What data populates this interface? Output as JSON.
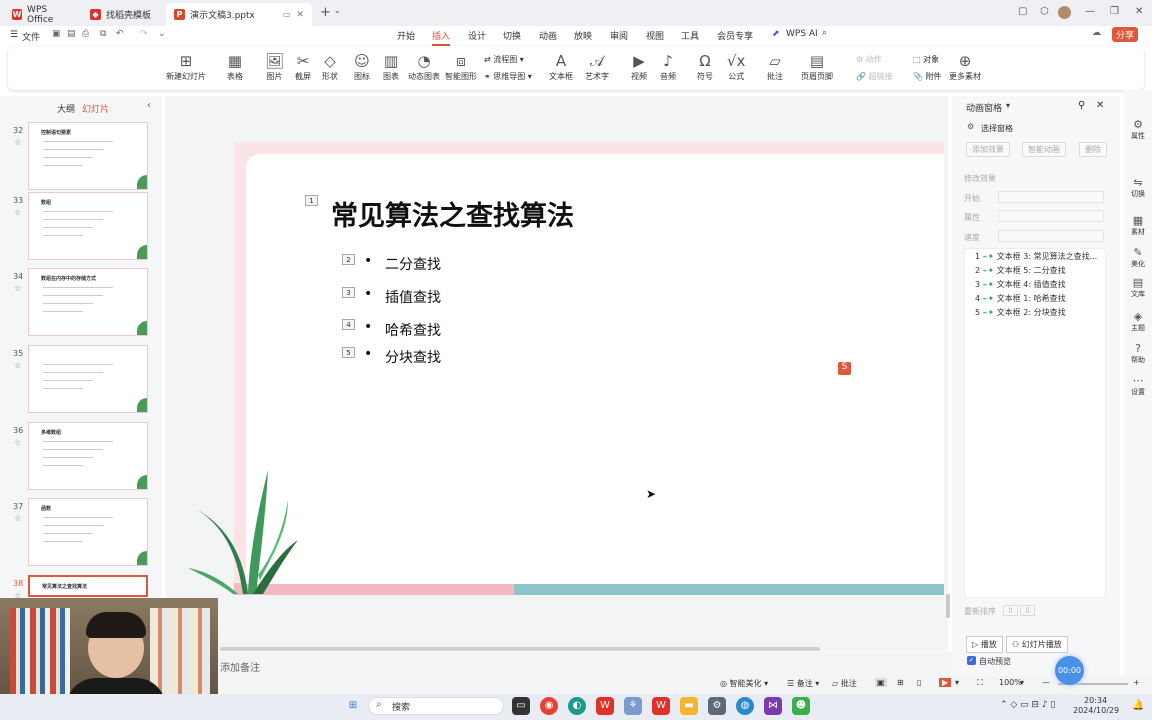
{
  "tabs": [
    {
      "label": "WPS Office",
      "icon": "wps-logo-icon",
      "color": "#e0312a"
    },
    {
      "label": "找稻壳模板",
      "icon": "daoke-icon",
      "color": "#e0312a"
    },
    {
      "label": "演示文稿3.pptx",
      "icon": "ppt-file-icon",
      "color": "#d9472b"
    }
  ],
  "menu": {
    "file": "文件",
    "items": [
      "开始",
      "插入",
      "设计",
      "切换",
      "动画",
      "放映",
      "审阅",
      "视图",
      "工具",
      "会员专享"
    ],
    "active": "插入",
    "wps_ai": "WPS AI",
    "share": "分享"
  },
  "ribbon": {
    "new_slide": "新建幻灯片",
    "table": "表格",
    "picture": "图片",
    "screenshot": "截屏",
    "shape": "形状",
    "icon": "图标",
    "chart": "图表",
    "dynamic_chart": "动态图表",
    "smart_graphic": "智能图形",
    "flowchart": "流程图",
    "mindmap": "思维导图",
    "textbox": "文本框",
    "wordart": "艺术字",
    "video": "视频",
    "audio": "音频",
    "symbol": "符号",
    "formula": "公式",
    "comment": "批注",
    "header_footer": "页眉页脚",
    "action": "动作",
    "hyperlink": "超链接",
    "object": "对象",
    "attachment": "附件",
    "more": "更多素材"
  },
  "left_panel": {
    "tab_outline": "大纲",
    "tab_slides": "幻灯片",
    "thumbnails": [
      {
        "num": "32",
        "title": "控制语句要素"
      },
      {
        "num": "33",
        "title": "数组"
      },
      {
        "num": "34",
        "title": "数组在内存中的存储方式"
      },
      {
        "num": "35",
        "title": ""
      },
      {
        "num": "36",
        "title": "多维数组"
      },
      {
        "num": "37",
        "title": "函数"
      },
      {
        "num": "38",
        "title": "常见算法之查找算法"
      }
    ]
  },
  "slide": {
    "title": "常见算法之查找算法",
    "title_num": "1",
    "bullets": [
      {
        "num": "2",
        "text": "二分查找"
      },
      {
        "num": "3",
        "text": "插值查找"
      },
      {
        "num": "4",
        "text": "哈希查找"
      },
      {
        "num": "5",
        "text": "分块查找"
      }
    ]
  },
  "notes_placeholder": "添加备注",
  "animation_pane": {
    "title": "动画窗格",
    "select_pane": "选择窗格",
    "add_effect": "添加效果",
    "smart_anim": "智能动画",
    "delete": "删除",
    "modify": "修改效果",
    "start": "开始",
    "property": "属性",
    "speed": "速度",
    "items": [
      {
        "num": "1",
        "text": "文本框 3: 常见算法之查找..."
      },
      {
        "num": "2",
        "text": "文本框 5: 二分查找"
      },
      {
        "num": "3",
        "text": "文本框 4: 插值查找"
      },
      {
        "num": "4",
        "text": "文本框 1: 哈希查找"
      },
      {
        "num": "5",
        "text": "文本框 2: 分块查找"
      }
    ],
    "reorder": "重新排序",
    "play": "播放",
    "slideshow": "幻灯片播放",
    "autopreview": "自动预览"
  },
  "side_toolbar": [
    "属性",
    "切换",
    "素材",
    "美化",
    "文库",
    "主题",
    "帮助",
    "设置"
  ],
  "status": {
    "smart_beautify": "智能美化",
    "notes": "备注",
    "comment": "批注",
    "zoom": "100%",
    "timer": "00:00"
  },
  "taskbar": {
    "search": "搜索",
    "time": "20:34",
    "date": "2024/10/29"
  },
  "colors": {
    "accent": "#e0573a",
    "slide_pink": "#fbe4e8",
    "teal": "#8fc6cc"
  }
}
